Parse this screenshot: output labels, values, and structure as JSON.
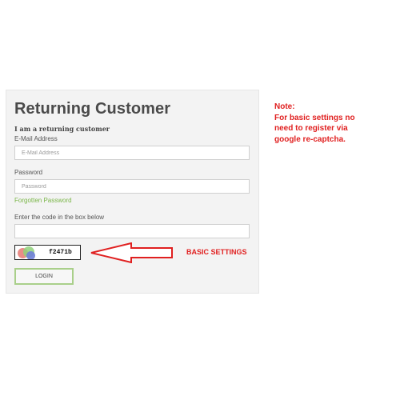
{
  "form": {
    "title": "Returning Customer",
    "subtitle": "I am a returning customer",
    "email_label": "E-Mail Address",
    "email_placeholder": "E-Mail Address",
    "email_value": "",
    "password_label": "Password",
    "password_placeholder": "Password",
    "password_value": "",
    "forgot_link": "Forgotten Password",
    "captcha_label": "Enter the code in the box below",
    "captcha_value": "",
    "captcha_code": "f2471b",
    "login_button": "LOGIN"
  },
  "annotation": {
    "arrow_label": "BASIC SETTINGS",
    "note_lines": [
      "Note:",
      "For basic settings no",
      "need to register via",
      "google re-captcha."
    ],
    "accent_color": "#e02020"
  },
  "colors": {
    "link": "#7ab648",
    "button_border": "#a9cf8a",
    "panel_bg": "#f3f3f3"
  }
}
